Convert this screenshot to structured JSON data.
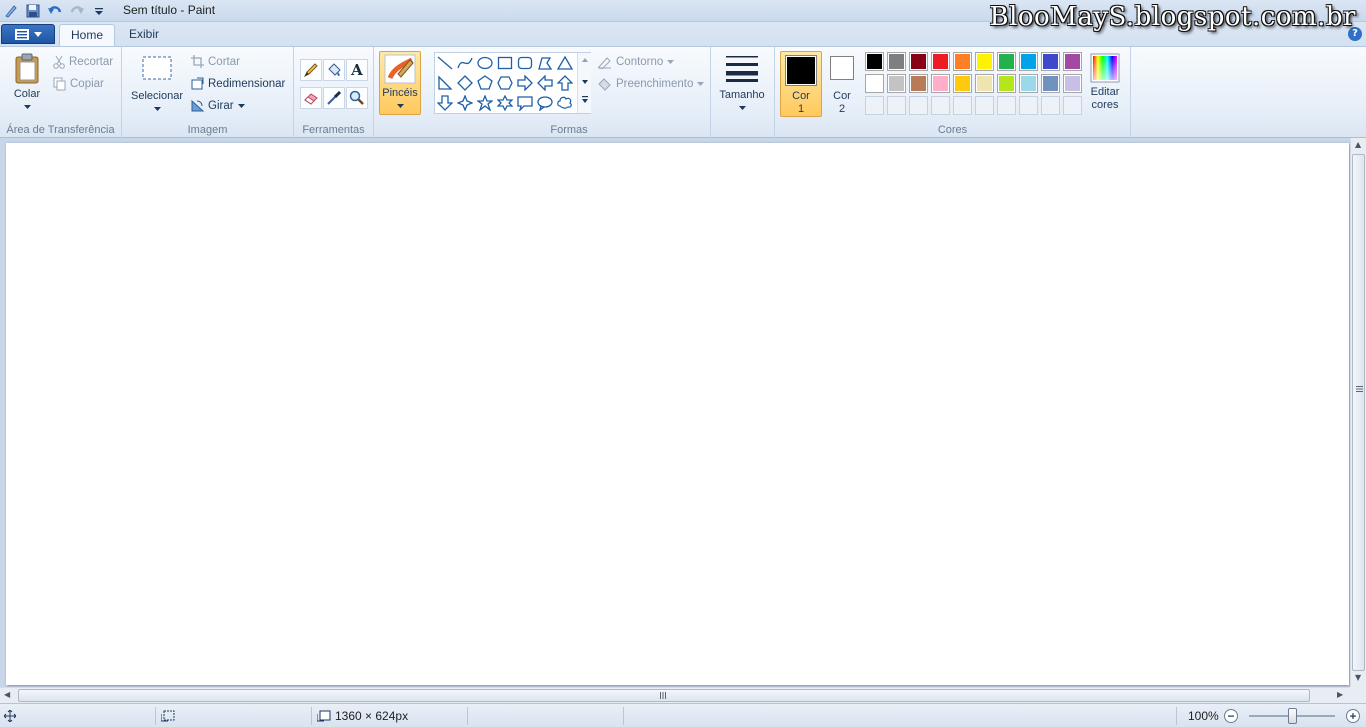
{
  "window": {
    "title": "Sem título - Paint"
  },
  "watermark": "BlooMayS.blogspot.com.br",
  "tabs": [
    {
      "label": "Home",
      "active": true
    },
    {
      "label": "Exibir",
      "active": false
    }
  ],
  "groups": {
    "clipboard": {
      "label": "Área de Transferência",
      "paste": "Colar",
      "cut": "Recortar",
      "copy": "Copiar"
    },
    "image": {
      "label": "Imagem",
      "select": "Selecionar",
      "crop": "Cortar",
      "resize": "Redimensionar",
      "rotate": "Girar"
    },
    "tools": {
      "label": "Ferramentas"
    },
    "brushes": {
      "label": "Pincéis"
    },
    "shapes": {
      "label": "Formas",
      "outline": "Contorno",
      "fill": "Preenchimento"
    },
    "size": {
      "label": "Tamanho"
    },
    "colors": {
      "label": "Cores",
      "color1": "Cor\n1",
      "color1_a": "Cor",
      "color1_b": "1",
      "color2_a": "Cor",
      "color2_b": "2",
      "edit_a": "Editar",
      "edit_b": "cores",
      "color1_value": "#000000",
      "color2_value": "#ffffff",
      "palette_row1": [
        "#000000",
        "#7f7f7f",
        "#880015",
        "#ed1c24",
        "#ff7f27",
        "#fff200",
        "#22b14c",
        "#00a2e8",
        "#3f48cc",
        "#a349a4"
      ],
      "palette_row2": [
        "#ffffff",
        "#c3c3c3",
        "#b97a57",
        "#ffaec9",
        "#ffc90e",
        "#efe4b0",
        "#b5e61d",
        "#99d9ea",
        "#7092be",
        "#c8bfe7"
      ],
      "palette_row3_empty": 10
    }
  },
  "status": {
    "canvas_size": "1360 × 624px",
    "zoom": "100%"
  },
  "accent": "#1f55a5",
  "highlight": "#ffd47f"
}
